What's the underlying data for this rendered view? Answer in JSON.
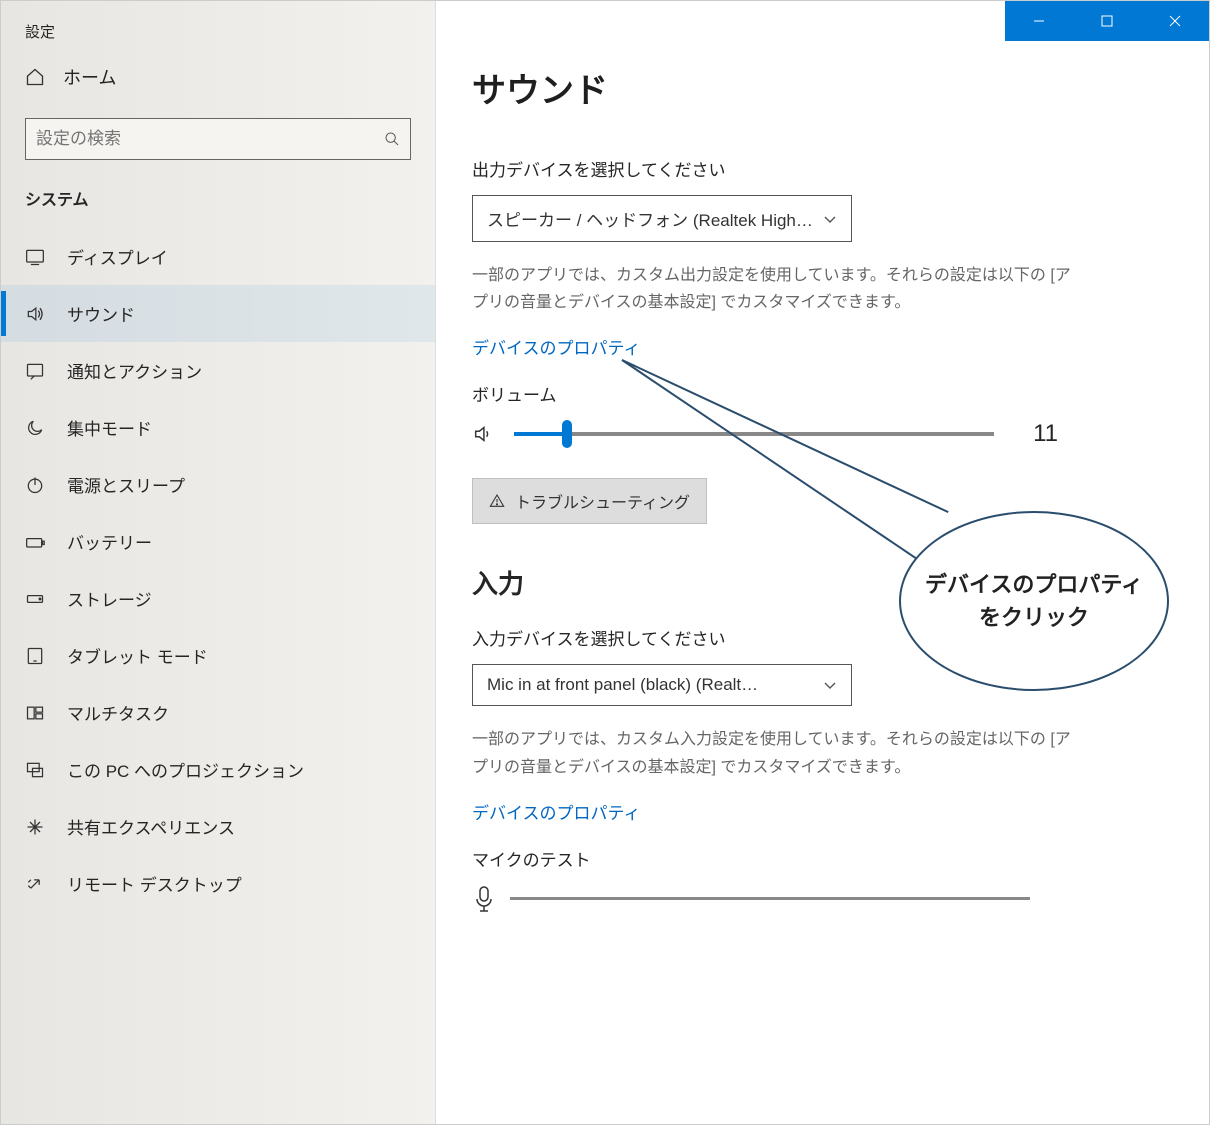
{
  "app_title": "設定",
  "home_label": "ホーム",
  "search_placeholder": "設定の検索",
  "section_heading": "システム",
  "sidebar": {
    "items": [
      {
        "label": "ディスプレイ"
      },
      {
        "label": "サウンド"
      },
      {
        "label": "通知とアクション"
      },
      {
        "label": "集中モード"
      },
      {
        "label": "電源とスリープ"
      },
      {
        "label": "バッテリー"
      },
      {
        "label": "ストレージ"
      },
      {
        "label": "タブレット モード"
      },
      {
        "label": "マルチタスク"
      },
      {
        "label": "この PC へのプロジェクション"
      },
      {
        "label": "共有エクスペリエンス"
      },
      {
        "label": "リモート デスクトップ"
      }
    ]
  },
  "page_title": "サウンド",
  "output": {
    "label": "出力デバイスを選択してください",
    "selected": "スピーカー / ヘッドフォン (Realtek High…",
    "desc": "一部のアプリでは、カスタム出力設定を使用しています。それらの設定は以下の [アプリの音量とデバイスの基本設定] でカスタマイズできます。",
    "link": "デバイスのプロパティ",
    "volume_label": "ボリューム",
    "volume_value": "11",
    "troubleshoot": "トラブルシューティング"
  },
  "input": {
    "title": "入力",
    "label": "入力デバイスを選択してください",
    "selected": "Mic in at front panel (black) (Realt…",
    "desc": "一部のアプリでは、カスタム入力設定を使用しています。それらの設定は以下の [アプリの音量とデバイスの基本設定] でカスタマイズできます。",
    "link": "デバイスのプロパティ",
    "mic_test": "マイクのテスト"
  },
  "callout_text": "デバイスのプロパティをクリック"
}
